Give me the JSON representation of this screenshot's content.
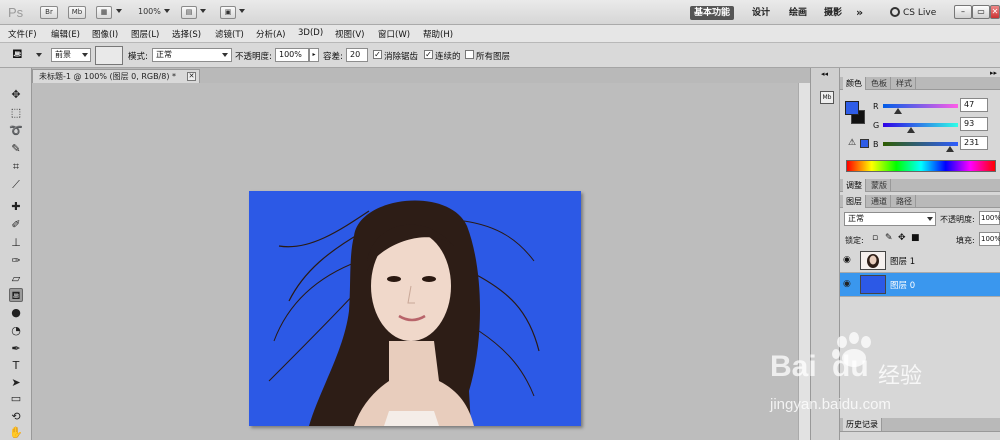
{
  "appbar": {
    "logo": "Ps",
    "btn_br": "Br",
    "btn_mb": "Mb",
    "zoom": "100%",
    "workspaces": [
      "基本功能",
      "设计",
      "绘画",
      "摄影"
    ],
    "more": "»",
    "cslive": "CS Live",
    "win_min": "–",
    "win_max": "▭",
    "win_close": "✕"
  },
  "menu": [
    "文件(F)",
    "编辑(E)",
    "图像(I)",
    "图层(L)",
    "选择(S)",
    "滤镜(T)",
    "分析(A)",
    "3D(D)",
    "视图(V)",
    "窗口(W)",
    "帮助(H)"
  ],
  "options": {
    "fill_source": "前景",
    "mode_label": "模式:",
    "mode_value": "正常",
    "opacity_label": "不透明度:",
    "opacity_value": "100%",
    "tolerance_label": "容差:",
    "tolerance_value": "20",
    "antialias_label": "消除锯齿",
    "antialias_checked": true,
    "contiguous_label": "连续的",
    "contiguous_checked": true,
    "all_layers_label": "所有图层",
    "all_layers_checked": false
  },
  "tools": [
    "move-tool",
    "marquee-tool",
    "lasso-tool",
    "quick-select-tool",
    "crop-tool",
    "eyedropper-tool",
    "spot-healing-tool",
    "brush-tool",
    "clone-stamp-tool",
    "history-brush-tool",
    "eraser-tool",
    "paint-bucket-tool",
    "blur-tool",
    "dodge-tool",
    "pen-tool",
    "type-tool",
    "path-select-tool",
    "rectangle-tool",
    "3d-rotate-tool",
    "hand-tool"
  ],
  "document": {
    "tab_title": "未标题-1 @ 100% (图层 0, RGB/8) *",
    "background_color": "#2c59e6"
  },
  "color_panel": {
    "tabs": [
      "颜色",
      "色板",
      "样式"
    ],
    "r_label": "R",
    "g_label": "G",
    "b_label": "B",
    "r": "47",
    "g": "93",
    "b": "231",
    "foreground": "#2f5de7",
    "background": "#111111"
  },
  "adjust_panel": {
    "tabs": [
      "调整",
      "蒙版"
    ]
  },
  "layers_panel": {
    "tabs": [
      "图层",
      "通道",
      "路径"
    ],
    "blend_mode": "正常",
    "opacity_label": "不透明度:",
    "opacity_value": "100%",
    "lock_label": "锁定:",
    "fill_label": "填充:",
    "fill_value": "100%",
    "layers": [
      {
        "name": "图层 1",
        "selected": false
      },
      {
        "name": "图层 0",
        "selected": true
      }
    ]
  },
  "history_panel": {
    "title": "历史记录"
  },
  "watermark": {
    "brand": "Bai",
    "brand2": "du",
    "cn": "经验",
    "url": "jingyan.baidu.com"
  }
}
